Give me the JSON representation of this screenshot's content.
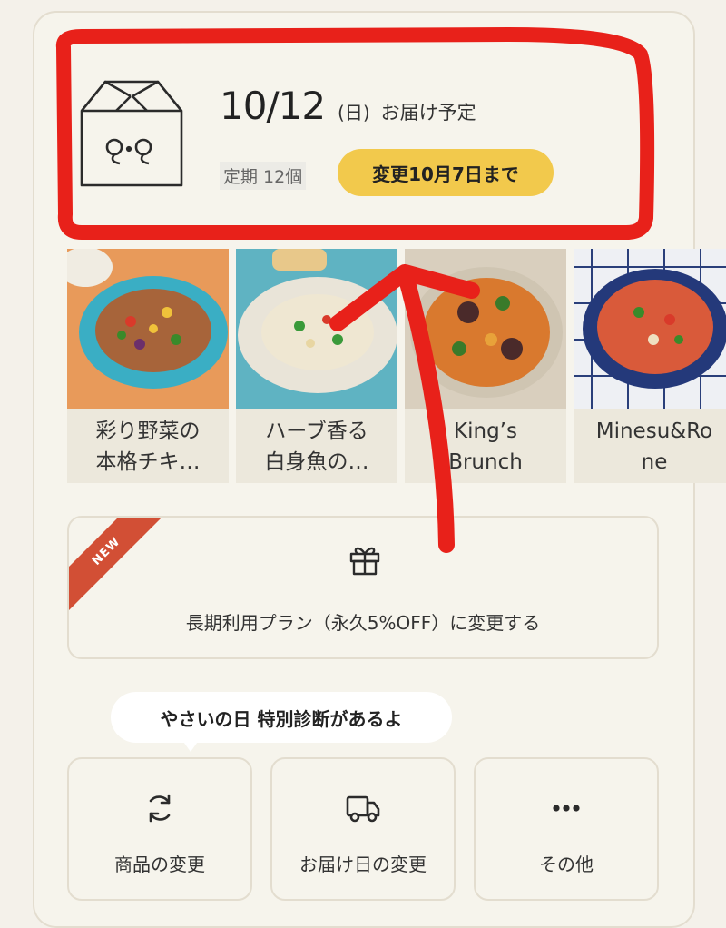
{
  "delivery": {
    "date": "10/12",
    "weekday": "(日)",
    "label": "お届け予定",
    "plan": "定期 12個",
    "change_button": "変更10月7日まで"
  },
  "box_logo_text": "96",
  "items": [
    {
      "name": "彩り野菜の\n本格チキ…"
    },
    {
      "name": "ハーブ香る\n白身魚の…"
    },
    {
      "name": "King’s\nBrunch"
    },
    {
      "name": "Minesu&Ro\nne"
    }
  ],
  "plan_cta": {
    "badge": "NEW",
    "label": "長期利用プラン（永久5%OFF）に変更する",
    "icon": "gift-icon"
  },
  "tooltip": "やさいの日 特別診断があるよ",
  "actions": [
    {
      "label": "商品の変更",
      "icon": "refresh-icon"
    },
    {
      "label": "お届け日の変更",
      "icon": "truck-icon"
    },
    {
      "label": "その他",
      "icon": "more-icon"
    }
  ],
  "colors": {
    "accent": "#f2c94c",
    "badge": "#d24f35",
    "annotation": "#e8211a",
    "background": "#f6f4ec"
  }
}
